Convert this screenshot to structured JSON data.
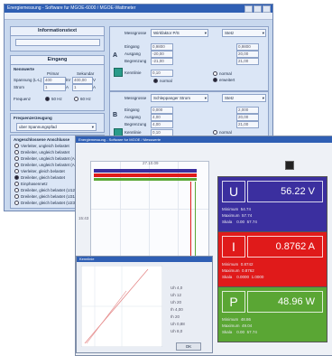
{
  "win1": {
    "title": "Energiemessung - Software fur MGOE-6000 / MGOE-Wattmeter",
    "info_title": "Informationstext",
    "eingang_title": "Eingang",
    "nennwerte": "Nennwerte",
    "primaer": "Primar",
    "sekundaer": "Sekundar",
    "spannung_label": "Spannung (L-L)",
    "spannung_primaer": "400",
    "spannung_unit1": "kV",
    "spannung_sek": "400,00",
    "spannung_unit2": "V",
    "strom_label": "Strom",
    "strom_primaer": "1",
    "strom_unit1": "A",
    "strom_sek": "1",
    "strom_unit2": "A",
    "frequenz_label": "Frequenz",
    "freq_opt1": "50 Hz",
    "freq_opt2": "60 Hz",
    "frequenzerzeugung": "Frequenzerzeugung",
    "freq_select": "uber Spannungspfad",
    "anschluss_title": "Angeschlossene Anschlusse",
    "anschluss_items": [
      "Vierleiter, ungleich belastet",
      "Dreileiter, ungleich belastet",
      "Dreileiter, ungleich belastet (Aron)",
      "Dreileiter, ungleich belastet (Aron)",
      "Vierleiter, gleich belastet",
      "Dreileiter, gleich belastet",
      "Einphasennetz",
      "Dreileiter, gleich belastet (U12)",
      "Dreileiter, gleich belastet (U31)",
      "Dreileiter, gleich belastet (U23)"
    ],
    "selected_index": 5,
    "block_a": {
      "letter": "A",
      "messgroesse_label": "Messgrosse",
      "messgroesse_value": "Wirkfaktor P/S",
      "stetz_value": "Stetz",
      "eingang_label": "Eingang",
      "eingang_value": "0,9800",
      "eingang_right": "0,9800",
      "ausgang_label": "Ausgang",
      "ausgang_value": "-20,00",
      "ausgang_right": "20,00",
      "begrenzung_label": "Begrenzung",
      "begrenzung_value": "-21,00",
      "begrenzung_right": "21,00",
      "kennlinie_label": "Kennlinie",
      "kennlinie_value": "0,10",
      "opt_normal": "normal",
      "opt_erweitert": "erweitert",
      "opt_normal2": "normal"
    },
    "block_b": {
      "letter": "B",
      "messgroesse_label": "Messgrosse",
      "messgroesse_value": "Schleppanger Strom",
      "stetz_value": "Stetz",
      "eingang_label": "Eingang",
      "eingang_value": "0,000",
      "eingang_right": "2,000",
      "ausgang_label": "Ausgang",
      "ausgang_value": "4,00",
      "ausgang_right": "20,00",
      "begrenzung_label": "Begrenzung",
      "begrenzung_value": "4,00",
      "begrenzung_right": "21,00",
      "kennlinie_label": "Kennlinie",
      "kennlinie_value": "0,10",
      "opt_normal": "normal",
      "opt_erweitert": "erweitert"
    }
  },
  "win2": {
    "title": "Energiemessung - Software fur MGOE / Messwerte",
    "chart_top_label": "27.10.09",
    "chart_mid_label": "15:43"
  },
  "meters": [
    {
      "symbol": "U",
      "value": "56.22 V",
      "color": "#3b2f9f",
      "min_label": "Minimum",
      "min_val": "54.74",
      "max_label": "Maximum",
      "max_val": "57.74",
      "skala_label": "Skala",
      "skala_lo": "0.00",
      "skala_hi": "57.74"
    },
    {
      "symbol": "I",
      "value": "0.8762 A",
      "color": "#e01a1a",
      "min_label": "Minimum",
      "min_val": "0.8742",
      "max_label": "Maximum",
      "max_val": "0.8762",
      "skala_label": "Skala",
      "skala_lo": "0.0000",
      "skala_hi": "1.0000"
    },
    {
      "symbol": "P",
      "value": "48.96 W",
      "color": "#5aa634",
      "min_label": "Minimum",
      "min_val": "48.86",
      "max_label": "Maximum",
      "max_val": "49.04",
      "skala_label": "Skala",
      "skala_lo": "0.00",
      "skala_hi": "57.74"
    }
  ],
  "win3": {
    "title": "Kennlinie",
    "readouts": [
      "Uh 4,0",
      "Uh 12",
      "Uh 20",
      "Ih 4,00",
      "Ih 20",
      "Uh 0,88",
      "Uh 8,0"
    ],
    "ok_label": "OK"
  },
  "colors": {
    "accent": "#2f5fb4",
    "teal": "#2a9b8a"
  }
}
